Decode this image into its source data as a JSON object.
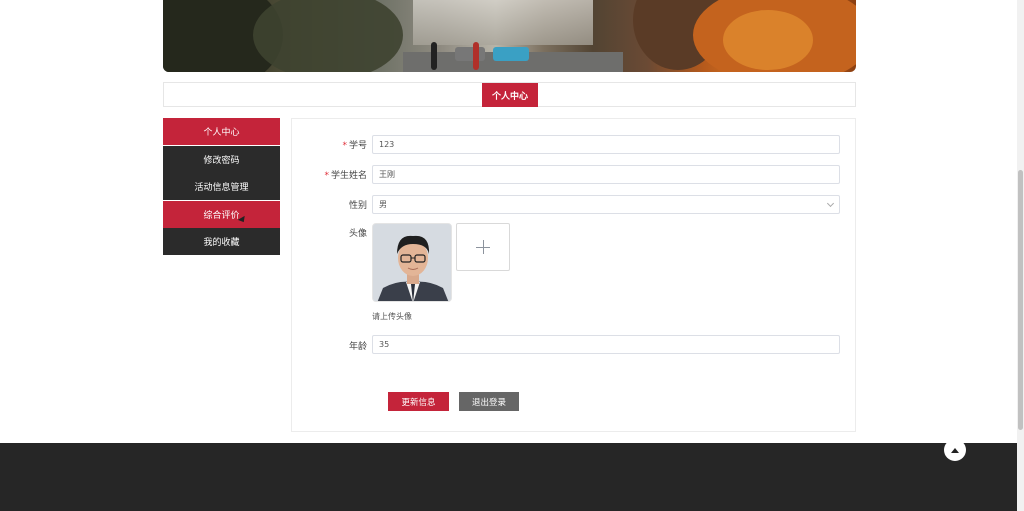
{
  "header": {
    "title": "个人中心"
  },
  "sidebar": {
    "items": [
      {
        "label": "个人中心"
      },
      {
        "label": "修改密码"
      },
      {
        "label": "活动信息管理"
      },
      {
        "label": "综合评价"
      },
      {
        "label": "我的收藏"
      }
    ]
  },
  "form": {
    "student_id": {
      "label": "学号",
      "value": "123"
    },
    "student_name": {
      "label": "学生姓名",
      "value": "王刚"
    },
    "gender": {
      "label": "性别",
      "value": "男"
    },
    "avatar": {
      "label": "头像",
      "hint": "请上传头像"
    },
    "age": {
      "label": "年龄",
      "value": "35"
    },
    "required_mark": "*"
  },
  "actions": {
    "update_label": "更新信息",
    "logout_label": "退出登录"
  },
  "colors": {
    "accent": "#c4243a",
    "sidebar_dark": "#2b2b2b",
    "footer": "#262626",
    "secondary_button": "#666666"
  },
  "icons": {
    "upload": "plus-icon",
    "back_to_top": "arrow-up-icon",
    "select": "chevron-down-icon"
  }
}
